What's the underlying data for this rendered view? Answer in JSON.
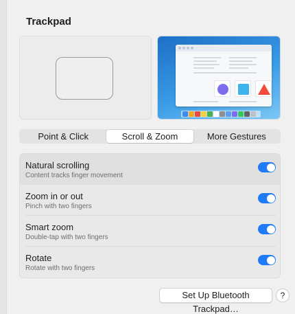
{
  "page": {
    "title": "Trackpad"
  },
  "tabs": [
    {
      "label": "Point & Click",
      "active": false
    },
    {
      "label": "Scroll & Zoom",
      "active": true
    },
    {
      "label": "More Gestures",
      "active": false
    }
  ],
  "settings": [
    {
      "title": "Natural scrolling",
      "subtitle": "Content tracks finger movement",
      "on": true
    },
    {
      "title": "Zoom in or out",
      "subtitle": "Pinch with two fingers",
      "on": true
    },
    {
      "title": "Smart zoom",
      "subtitle": "Double-tap with two fingers",
      "on": true
    },
    {
      "title": "Rotate",
      "subtitle": "Rotate with two fingers",
      "on": true
    }
  ],
  "footer": {
    "setup_button": "Set Up Bluetooth Trackpad…",
    "help_button": "?"
  },
  "colors": {
    "accent": "#1f7cf6",
    "preview_circle": "#7b6cf0",
    "preview_square": "#3db4f0",
    "preview_triangle": "#f24b3a"
  },
  "dock_colors": [
    "#3b8cf0",
    "#f5a623",
    "#e84c3d",
    "#f0d43a",
    "#4caf50",
    "#ffffff",
    "#8e8e93",
    "#5e9cf0",
    "#7b6cf0",
    "#34c759",
    "#636366",
    "#c0c0c0"
  ]
}
